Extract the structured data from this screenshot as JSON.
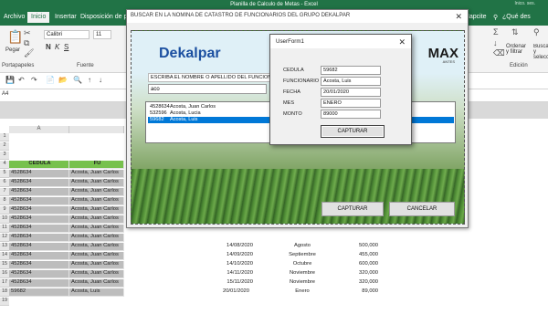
{
  "window": {
    "title": "Planilla de Calculo de Metas - Excel",
    "user": "Inico. ses."
  },
  "tabs": [
    "Archivo",
    "Inicio",
    "Insertar",
    "Disposición de pág"
  ],
  "tabs_right": [
    "Mapcite",
    "¿Qué des"
  ],
  "ribbon": {
    "paste_label": "Pegar",
    "clipboard_label": "Portapapeles",
    "font_label": "Fuente",
    "font_name": "Calibri",
    "font_size": "11",
    "editing_label": "Edición",
    "sort_label": "Ordenar y filtrar",
    "find_label": "Buscar y seleccionar"
  },
  "namebox": "A4",
  "sheet": {
    "col_a": "A",
    "col_header_cedula": "CEDULA",
    "col_header_f": "FU",
    "row_numbers": [
      "1",
      "2",
      "3",
      "4",
      "5",
      "6",
      "7",
      "8",
      "9",
      "10",
      "11",
      "12",
      "13",
      "14",
      "15",
      "16",
      "17",
      "18",
      "19"
    ],
    "rows": [
      {
        "cedula": "4528634",
        "name": "Acosta, Juan Carlos",
        "date": "",
        "month": "",
        "amount": ""
      },
      {
        "cedula": "4528634",
        "name": "Acosta, Juan Carlos",
        "date": "",
        "month": "",
        "amount": ""
      },
      {
        "cedula": "4528634",
        "name": "Acosta, Juan Carlos",
        "date": "",
        "month": "",
        "amount": ""
      },
      {
        "cedula": "4528634",
        "name": "Acosta, Juan Carlos",
        "date": "",
        "month": "",
        "amount": ""
      },
      {
        "cedula": "4528634",
        "name": "Acosta, Juan Carlos",
        "date": "",
        "month": "",
        "amount": ""
      },
      {
        "cedula": "4528634",
        "name": "Acosta, Juan Carlos",
        "date": "",
        "month": "",
        "amount": ""
      },
      {
        "cedula": "4528634",
        "name": "Acosta, Juan Carlos",
        "date": "",
        "month": "",
        "amount": ""
      },
      {
        "cedula": "4528634",
        "name": "Acosta, Juan Carlos",
        "date": "",
        "month": "",
        "amount": ""
      },
      {
        "cedula": "4528634",
        "name": "Acosta, Juan Carlos",
        "date": "14/08/2020",
        "month": "Agosto",
        "amount": "500,000"
      },
      {
        "cedula": "4528634",
        "name": "Acosta, Juan Carlos",
        "date": "14/09/2020",
        "month": "Septiembre",
        "amount": "455,000"
      },
      {
        "cedula": "4528634",
        "name": "Acosta, Juan Carlos",
        "date": "14/10/2020",
        "month": "Octubre",
        "amount": "600,000"
      },
      {
        "cedula": "4528634",
        "name": "Acosta, Juan Carlos",
        "date": "14/11/2020",
        "month": "Noviembre",
        "amount": "320,000"
      },
      {
        "cedula": "4528634",
        "name": "Acosta, Juan Carlos",
        "date": "15/11/2020",
        "month": "Noviembre",
        "amount": "320,000"
      },
      {
        "cedula": "59682",
        "name": "Acosta, Luis",
        "date": "20/01/2020",
        "month": "Enero",
        "amount": "89,000"
      }
    ]
  },
  "search_dialog": {
    "title": "BUSCAR EN LA NOMINA DE CATASTRO DE FUNCIONARIOS DEL GRUPO DEKALPAR",
    "logo": "Dekalpar",
    "logo2": "MAX",
    "logo2_sub": "ANTES",
    "prompt": "ESCRIBA EL NOMBRE O APELLIDO DEL FUNCIONARIO",
    "search_value": "aco",
    "results": [
      {
        "code": "4528634",
        "name": "Acosta, Juan Carlos"
      },
      {
        "code": "532596",
        "name": "Acosta, Lucia"
      },
      {
        "code": "59682",
        "name": "Acosta, Luis"
      }
    ],
    "capture_label": "CAPTURAR",
    "cancel_label": "CANCELAR"
  },
  "userform": {
    "title": "UserForm1",
    "fields": [
      {
        "label": "CEDULA",
        "value": "59682"
      },
      {
        "label": "FUNCIONARIO",
        "value": "Acosta, Luis"
      },
      {
        "label": "FECHA",
        "value": "20/01/2020"
      },
      {
        "label": "MES",
        "value": "ENERO"
      },
      {
        "label": "MONTO",
        "value": "89000"
      }
    ],
    "capture_label": "CAPTURAR"
  }
}
